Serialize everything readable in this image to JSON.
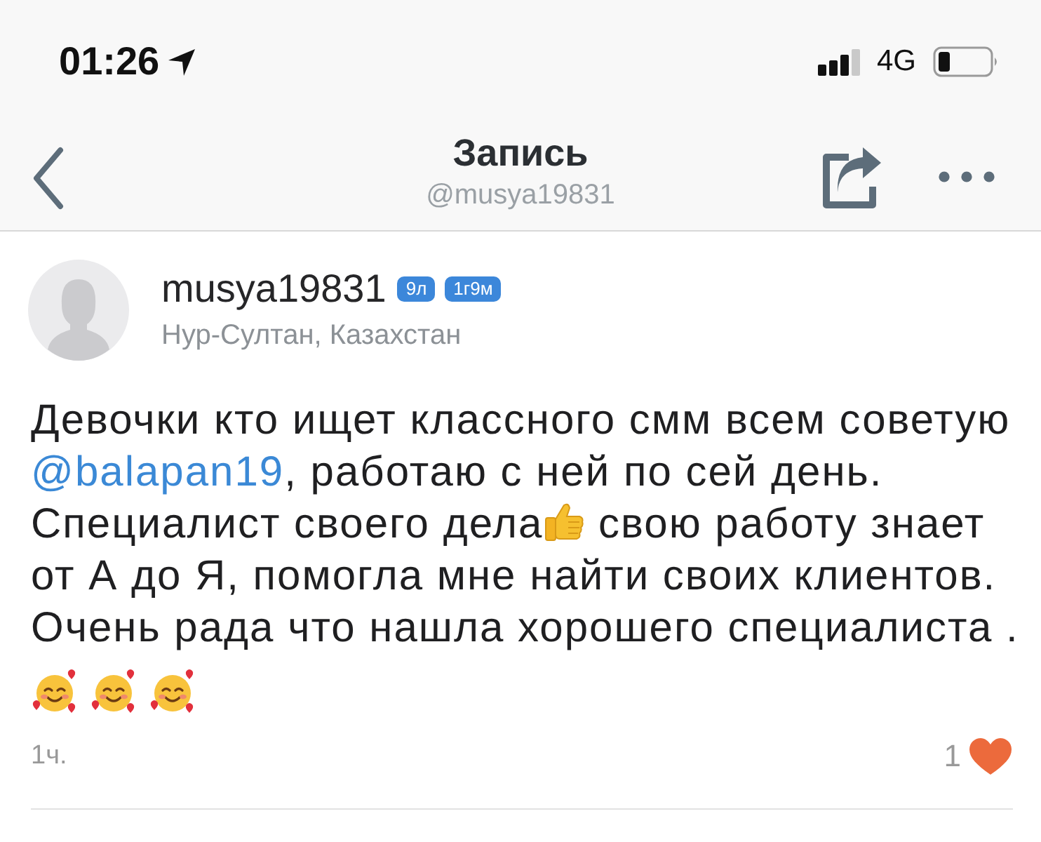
{
  "status_bar": {
    "time": "01:26",
    "network": "4G"
  },
  "nav_bar": {
    "title": "Запись",
    "subtitle": "@musya19831"
  },
  "post": {
    "author": {
      "username": "musya19831",
      "badges": [
        "9л",
        "1г9м"
      ],
      "location": "Нур-Султан, Казахстан"
    },
    "body": [
      {
        "kind": "text",
        "text": "Девочки кто ищет классного смм всем советую "
      },
      {
        "kind": "mention",
        "text": "@balapan19"
      },
      {
        "kind": "text",
        "text": ", работаю с ней по сей день. Специалист своего дела"
      },
      {
        "kind": "thumbs"
      },
      {
        "kind": "text",
        "text": " свою работу знает от А до Я, помогла мне найти своих клиентов. Очень рада что нашла хорошего специалиста ."
      }
    ],
    "emoji_row": [
      {
        "kind": "smiley"
      },
      {
        "kind": "smiley"
      },
      {
        "kind": "smiley"
      }
    ],
    "time": "1ч.",
    "likes": {
      "count": "1",
      "liked": true
    }
  }
}
